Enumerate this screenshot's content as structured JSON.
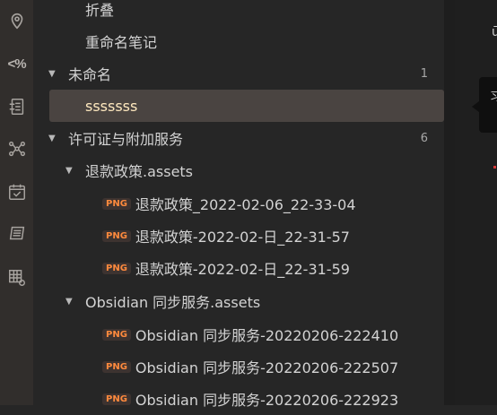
{
  "tree": {
    "rows": [
      {
        "label": "折叠"
      },
      {
        "label": "重命名笔记"
      },
      {
        "label": "未命名",
        "count": "1"
      },
      {
        "label": "sssssss"
      },
      {
        "label": "许可证与附加服务",
        "count": "6"
      },
      {
        "label": "退款政策.assets"
      },
      {
        "badge": "PNG",
        "label": "退款政策_2022-02-06_22-33-04"
      },
      {
        "badge": "PNG",
        "label": "退款政策-2022-02-日_22-31-57"
      },
      {
        "badge": "PNG",
        "label": "退款政策-2022-02-日_22-31-59"
      },
      {
        "label": "Obsidian 同步服务.assets"
      },
      {
        "badge": "PNG",
        "label": "Obsidian 同步服务-20220206-222410"
      },
      {
        "badge": "PNG",
        "label": "Obsidian 同步服务-20220206-222507"
      },
      {
        "badge": "PNG",
        "label": "Obsidian 同步服务-20220206-222923"
      }
    ]
  },
  "ribbon": {
    "templater_label": "<%",
    "icons": [
      "map-pin-icon",
      "templater-icon",
      "file-tree-icon",
      "graph-icon",
      "calendar-check-icon",
      "slides-icon",
      "grid-gear-icon"
    ]
  },
  "right_edge": {
    "char1": "ū",
    "char2": "习"
  }
}
